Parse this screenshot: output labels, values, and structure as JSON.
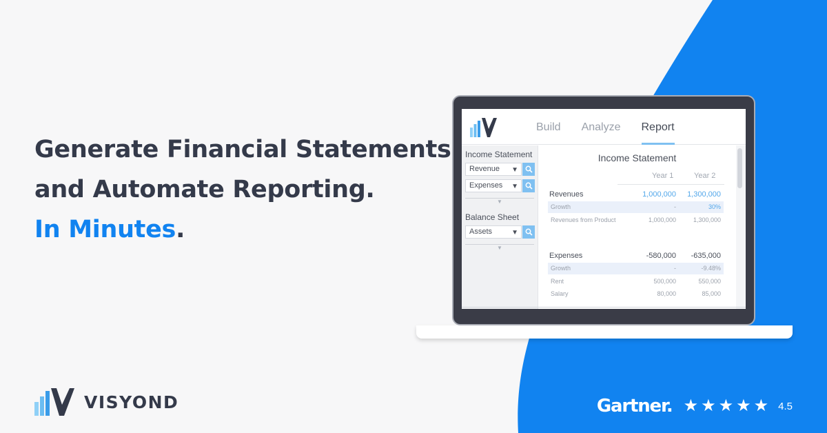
{
  "headline": {
    "line1": "Generate Financial Statements",
    "line2": "and Automate Reporting.",
    "accent": "In Minutes",
    "accent_suffix": "."
  },
  "brand": {
    "name": "VISYOND"
  },
  "gartner": {
    "name": "Gartner.",
    "stars": 5,
    "rating": "4.5"
  },
  "colors": {
    "accent": "#1183f0",
    "background": "#f7f7f8",
    "text": "#343a4a"
  },
  "app": {
    "tabs": [
      {
        "label": "Build",
        "active": false
      },
      {
        "label": "Analyze",
        "active": false
      },
      {
        "label": "Report",
        "active": true
      }
    ],
    "sidebar": {
      "section1_title": "Income Statement",
      "section1_items": [
        "Revenue",
        "Expenses"
      ],
      "section2_title": "Balance Sheet",
      "section2_items": [
        "Assets"
      ]
    },
    "report": {
      "title": "Income Statement",
      "columns": [
        "Year 1",
        "Year 2"
      ],
      "rows": [
        {
          "label": "Revenues",
          "v1": "1,000,000",
          "v2": "1,300,000"
        },
        {
          "label": "Growth",
          "v1": "-",
          "v2": "30%"
        },
        {
          "label": "Revenues from Product",
          "v1": "1,000,000",
          "v2": "1,300,000"
        },
        {
          "label": "Expenses",
          "v1": "-580,000",
          "v2": "-635,000"
        },
        {
          "label": "Growth",
          "v1": "-",
          "v2": "-9.48%"
        },
        {
          "label": "Rent",
          "v1": "500,000",
          "v2": "550,000"
        },
        {
          "label": "Salary",
          "v1": "80,000",
          "v2": "85,000"
        }
      ]
    }
  }
}
